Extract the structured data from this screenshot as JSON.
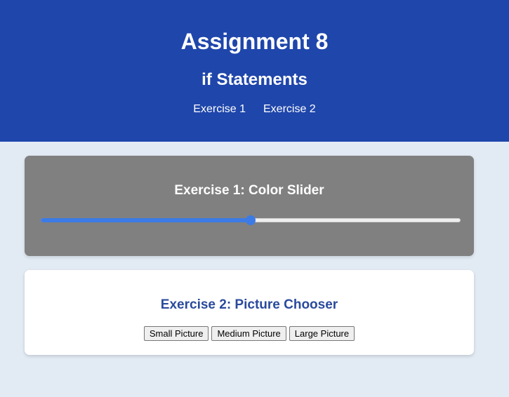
{
  "header": {
    "title": "Assignment 8",
    "subtitle": "if Statements",
    "nav": [
      {
        "label": "Exercise 1"
      },
      {
        "label": "Exercise 2"
      }
    ],
    "background_color": "#1f46ab"
  },
  "exercise1": {
    "heading": "Exercise 1: Color Slider",
    "slider": {
      "value": 50,
      "min": 0,
      "max": 100
    },
    "card_color": "#808080",
    "accent_color": "#3c7be6"
  },
  "exercise2": {
    "heading": "Exercise 2: Picture Chooser",
    "buttons": [
      {
        "label": "Small Picture"
      },
      {
        "label": "Medium Picture"
      },
      {
        "label": "Large Picture"
      }
    ],
    "heading_color": "#2a4a9c"
  },
  "page_background": "#e2eaf4"
}
